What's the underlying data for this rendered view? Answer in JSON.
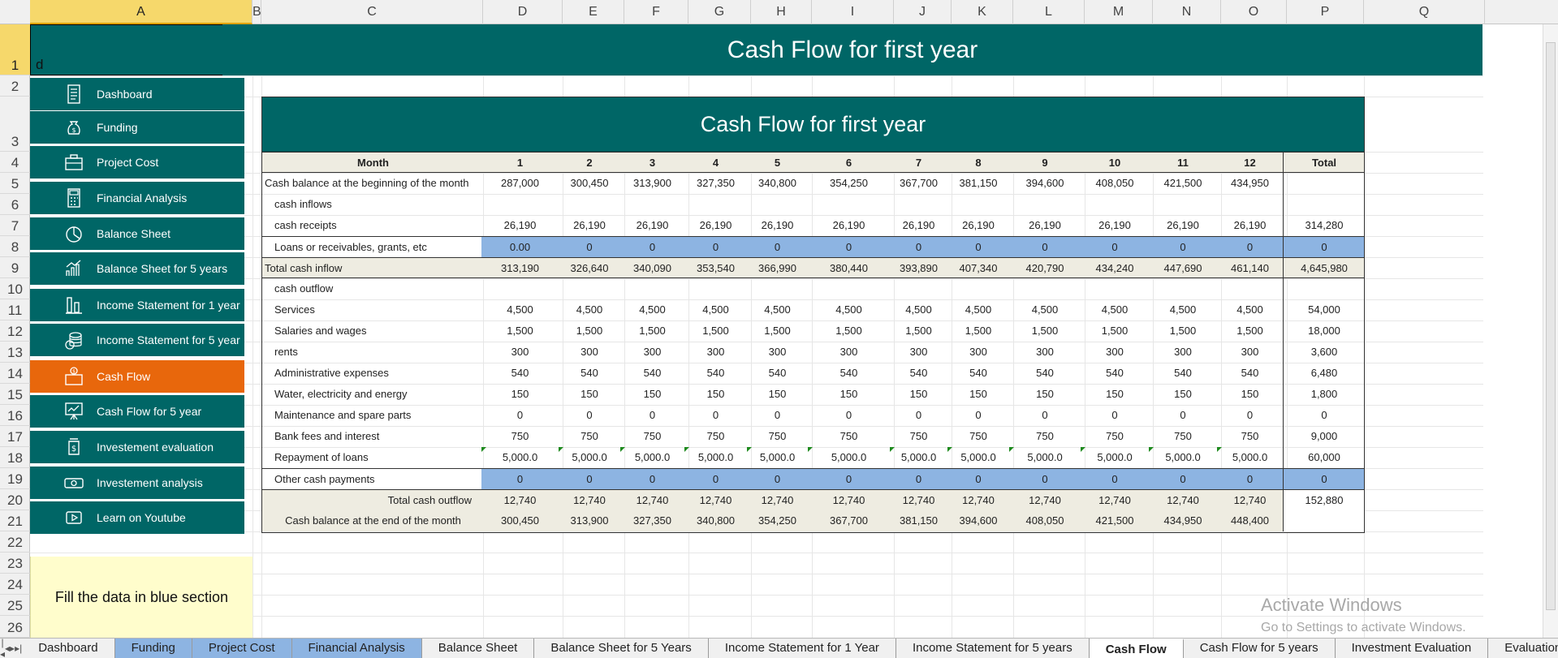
{
  "columns": [
    "A",
    "B",
    "C",
    "D",
    "E",
    "F",
    "G",
    "H",
    "I",
    "J",
    "K",
    "L",
    "M",
    "N",
    "O",
    "P",
    "Q"
  ],
  "rows": [
    "1",
    "2",
    "3",
    "4",
    "5",
    "6",
    "7",
    "8",
    "9",
    "10",
    "11",
    "12",
    "13",
    "14",
    "15",
    "16",
    "17",
    "18",
    "19",
    "20",
    "21",
    "22",
    "23",
    "24",
    "25",
    "26"
  ],
  "cell_a1": "d",
  "banner_title": "Cash Flow for first year",
  "sidebar": [
    {
      "label": "Dashboard",
      "icon": "document-icon"
    },
    {
      "label": "Funding",
      "icon": "money-bag-icon"
    },
    {
      "label": "Project Cost",
      "icon": "briefcase-icon"
    },
    {
      "label": "Financial Analysis",
      "icon": "calculator-icon"
    },
    {
      "label": "Balance Sheet",
      "icon": "pie-chart-icon"
    },
    {
      "label": "Balance Sheet for 5 years",
      "icon": "growth-chart-icon"
    },
    {
      "label": "Income Statement for 1 year",
      "icon": "bar-chart-icon"
    },
    {
      "label": "Income Statement for 5 year",
      "icon": "coins-icon"
    },
    {
      "label": "Cash Flow",
      "icon": "cash-box-icon"
    },
    {
      "label": "Cash Flow for 5 year",
      "icon": "presentation-chart-icon"
    },
    {
      "label": "Investement evaluation",
      "icon": "dollar-jar-icon"
    },
    {
      "label": "Investement analysis",
      "icon": "banknote-icon"
    },
    {
      "label": "Learn on Youtube",
      "icon": "play-icon"
    }
  ],
  "note": "Fill the data in blue section",
  "table": {
    "title": "Cash Flow for first year",
    "header": {
      "label": "Month",
      "months": [
        "1",
        "2",
        "3",
        "4",
        "5",
        "6",
        "7",
        "8",
        "9",
        "10",
        "11",
        "12"
      ],
      "total": "Total"
    },
    "rows": [
      {
        "label": "Cash balance at the beginning of the month",
        "style": "plain",
        "values": [
          "287,000",
          "300,450",
          "313,900",
          "327,350",
          "340,800",
          "354,250",
          "367,700",
          "381,150",
          "394,600",
          "408,050",
          "421,500",
          "434,950"
        ],
        "total": ""
      },
      {
        "label": "cash inflows",
        "style": "indent",
        "values": [
          "",
          "",
          "",
          "",
          "",
          "",
          "",
          "",
          "",
          "",
          "",
          ""
        ],
        "total": ""
      },
      {
        "label": "cash receipts",
        "style": "indent",
        "values": [
          "26,190",
          "26,190",
          "26,190",
          "26,190",
          "26,190",
          "26,190",
          "26,190",
          "26,190",
          "26,190",
          "26,190",
          "26,190",
          "26,190"
        ],
        "total": "314,280"
      },
      {
        "label": "Loans or receivables, grants, etc",
        "style": "indent-blue",
        "values": [
          "0.00",
          "0",
          "0",
          "0",
          "0",
          "0",
          "0",
          "0",
          "0",
          "0",
          "0",
          "0"
        ],
        "total": "0"
      },
      {
        "label": "Total cash inflow",
        "style": "beige",
        "values": [
          "313,190",
          "326,640",
          "340,090",
          "353,540",
          "366,990",
          "380,440",
          "393,890",
          "407,340",
          "420,790",
          "434,240",
          "447,690",
          "461,140"
        ],
        "total": "4,645,980"
      },
      {
        "label": "cash outflow",
        "style": "indent",
        "values": [
          "",
          "",
          "",
          "",
          "",
          "",
          "",
          "",
          "",
          "",
          "",
          ""
        ],
        "total": ""
      },
      {
        "label": "Services",
        "style": "indent",
        "values": [
          "4,500",
          "4,500",
          "4,500",
          "4,500",
          "4,500",
          "4,500",
          "4,500",
          "4,500",
          "4,500",
          "4,500",
          "4,500",
          "4,500"
        ],
        "total": "54,000"
      },
      {
        "label": "Salaries and wages",
        "style": "indent",
        "values": [
          "1,500",
          "1,500",
          "1,500",
          "1,500",
          "1,500",
          "1,500",
          "1,500",
          "1,500",
          "1,500",
          "1,500",
          "1,500",
          "1,500"
        ],
        "total": "18,000"
      },
      {
        "label": "rents",
        "style": "indent",
        "values": [
          "300",
          "300",
          "300",
          "300",
          "300",
          "300",
          "300",
          "300",
          "300",
          "300",
          "300",
          "300"
        ],
        "total": "3,600"
      },
      {
        "label": "Administrative expenses",
        "style": "indent",
        "values": [
          "540",
          "540",
          "540",
          "540",
          "540",
          "540",
          "540",
          "540",
          "540",
          "540",
          "540",
          "540"
        ],
        "total": "6,480"
      },
      {
        "label": "Water, electricity and energy",
        "style": "indent",
        "values": [
          "150",
          "150",
          "150",
          "150",
          "150",
          "150",
          "150",
          "150",
          "150",
          "150",
          "150",
          "150"
        ],
        "total": "1,800"
      },
      {
        "label": "Maintenance and spare parts",
        "style": "indent",
        "values": [
          "0",
          "0",
          "0",
          "0",
          "0",
          "0",
          "0",
          "0",
          "0",
          "0",
          "0",
          "0"
        ],
        "total": "0"
      },
      {
        "label": "Bank fees and interest",
        "style": "indent",
        "values": [
          "750",
          "750",
          "750",
          "750",
          "750",
          "750",
          "750",
          "750",
          "750",
          "750",
          "750",
          "750"
        ],
        "total": "9,000"
      },
      {
        "label": "Repayment of loans",
        "style": "indent-marked",
        "values": [
          "5,000.0",
          "5,000.0",
          "5,000.0",
          "5,000.0",
          "5,000.0",
          "5,000.0",
          "5,000.0",
          "5,000.0",
          "5,000.0",
          "5,000.0",
          "5,000.0",
          "5,000.0"
        ],
        "total": "60,000"
      },
      {
        "label": "Other cash payments",
        "style": "indent-blue-data",
        "values": [
          "0",
          "0",
          "0",
          "0",
          "0",
          "0",
          "0",
          "0",
          "0",
          "0",
          "0",
          "0"
        ],
        "total": "0"
      },
      {
        "label": "Total cash outflow",
        "style": "beige-right",
        "values": [
          "12,740",
          "12,740",
          "12,740",
          "12,740",
          "12,740",
          "12,740",
          "12,740",
          "12,740",
          "12,740",
          "12,740",
          "12,740",
          "12,740"
        ],
        "total": "152,880"
      },
      {
        "label": "Cash balance at the end of the month",
        "style": "beige-center",
        "values": [
          "300,450",
          "313,900",
          "327,350",
          "340,800",
          "354,250",
          "367,700",
          "381,150",
          "394,600",
          "408,050",
          "421,500",
          "434,950",
          "448,400"
        ],
        "total": ""
      }
    ]
  },
  "watermark": {
    "line1": "Activate Windows",
    "line2": "Go to Settings to activate Windows."
  },
  "sheet_tabs": [
    {
      "label": "Dashboard",
      "state": "normal"
    },
    {
      "label": "Funding",
      "state": "colored"
    },
    {
      "label": "Project Cost",
      "state": "colored"
    },
    {
      "label": "Financial Analysis",
      "state": "colored"
    },
    {
      "label": "Balance Sheet",
      "state": "normal"
    },
    {
      "label": "Balance Sheet for 5 Years",
      "state": "normal"
    },
    {
      "label": "Income Statement for 1 Year",
      "state": "normal"
    },
    {
      "label": "Income Statement for 5 years",
      "state": "normal"
    },
    {
      "label": "Cash Flow",
      "state": "active"
    },
    {
      "label": "Cash Flow for 5 years",
      "state": "normal"
    },
    {
      "label": "Investment Evaluation",
      "state": "normal"
    },
    {
      "label": "Evaluation",
      "state": "normal"
    }
  ],
  "tab_nav": [
    "first-tab",
    "prev-tab",
    "next-tab",
    "last-tab"
  ]
}
